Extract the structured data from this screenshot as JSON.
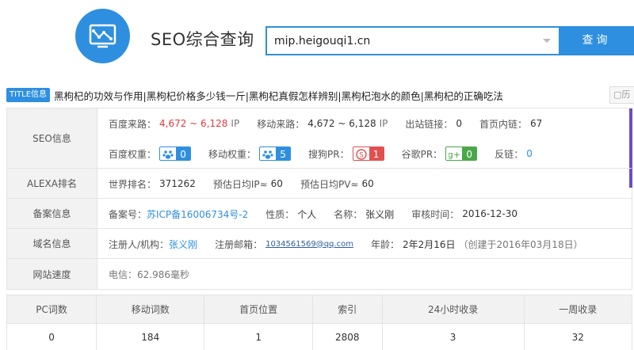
{
  "header": {
    "brand": "SEO综合查询",
    "search_value": "mip.heigouqi1.cn",
    "search_button": "查询",
    "logo_icon": "chart-monitor-icon"
  },
  "title_row": {
    "badge": "TITLE信息",
    "text": "黑枸杞的功效与作用|黑枸杞价格多少钱一斤|黑枸杞真假怎样辨别|黑枸杞泡水的颜色|黑枸杞的正确吃法",
    "side_button": "历"
  },
  "seo": {
    "label": "SEO信息",
    "baidu_traffic_label": "百度来路：",
    "baidu_traffic_value": "4,672 ~ 6,128",
    "baidu_traffic_unit": "IP",
    "mobile_traffic_label": "移动来路：",
    "mobile_traffic_value": "4,672 ~ 6,128",
    "mobile_traffic_unit": "IP",
    "outbound_label": "出站链接：",
    "outbound_value": "0",
    "homepage_links_label": "首页内链：",
    "homepage_links_value": "67",
    "baidu_weight_label": "百度权重：",
    "baidu_weight_value": "0",
    "mobile_weight_label": "移动权重：",
    "mobile_weight_value": "5",
    "sogou_pr_label": "搜狗PR：",
    "sogou_pr_value": "1",
    "google_pr_label": "谷歌PR：",
    "google_pr_value": "0",
    "backlinks_label": "反链：",
    "backlinks_value": "0"
  },
  "alexa": {
    "label": "ALEXA排名",
    "world_rank_label": "世界排名：",
    "world_rank_value": "371262",
    "est_ip_label": "预估日均IP≈",
    "est_ip_value": "60",
    "est_pv_label": "预估日均PV≈",
    "est_pv_value": "60"
  },
  "icp": {
    "label": "备案信息",
    "number_label": "备案号：",
    "number_value": "苏ICP备16006734号-2",
    "nature_label": "性质：",
    "nature_value": "个人",
    "name_label": "名称：",
    "name_value": "张义刚",
    "audit_label": "审核时间：",
    "audit_value": "2016-12-30"
  },
  "domain": {
    "label": "域名信息",
    "registrant_label": "注册人/机构：",
    "registrant_value": "张义刚",
    "email_label": "注册邮箱：",
    "email_value": "1034561569@qq.com",
    "age_label": "年龄：",
    "age_value": "2年2月16日",
    "created_note": "（创建于2016年03月18日）"
  },
  "speed": {
    "label": "网站速度",
    "value": "电信：62.986毫秒"
  },
  "stats": {
    "headers": [
      "PC词数",
      "移动词数",
      "首页位置",
      "索引",
      "24小时收录",
      "一周收录"
    ],
    "values": [
      "0",
      "184",
      "1",
      "2808",
      "3",
      "32"
    ]
  },
  "colors": {
    "accent": "#2e8fe0",
    "red": "#e4393c",
    "sogou": "#e05050",
    "google": "#4aa84a",
    "side_accent": "#6a4fc9"
  }
}
